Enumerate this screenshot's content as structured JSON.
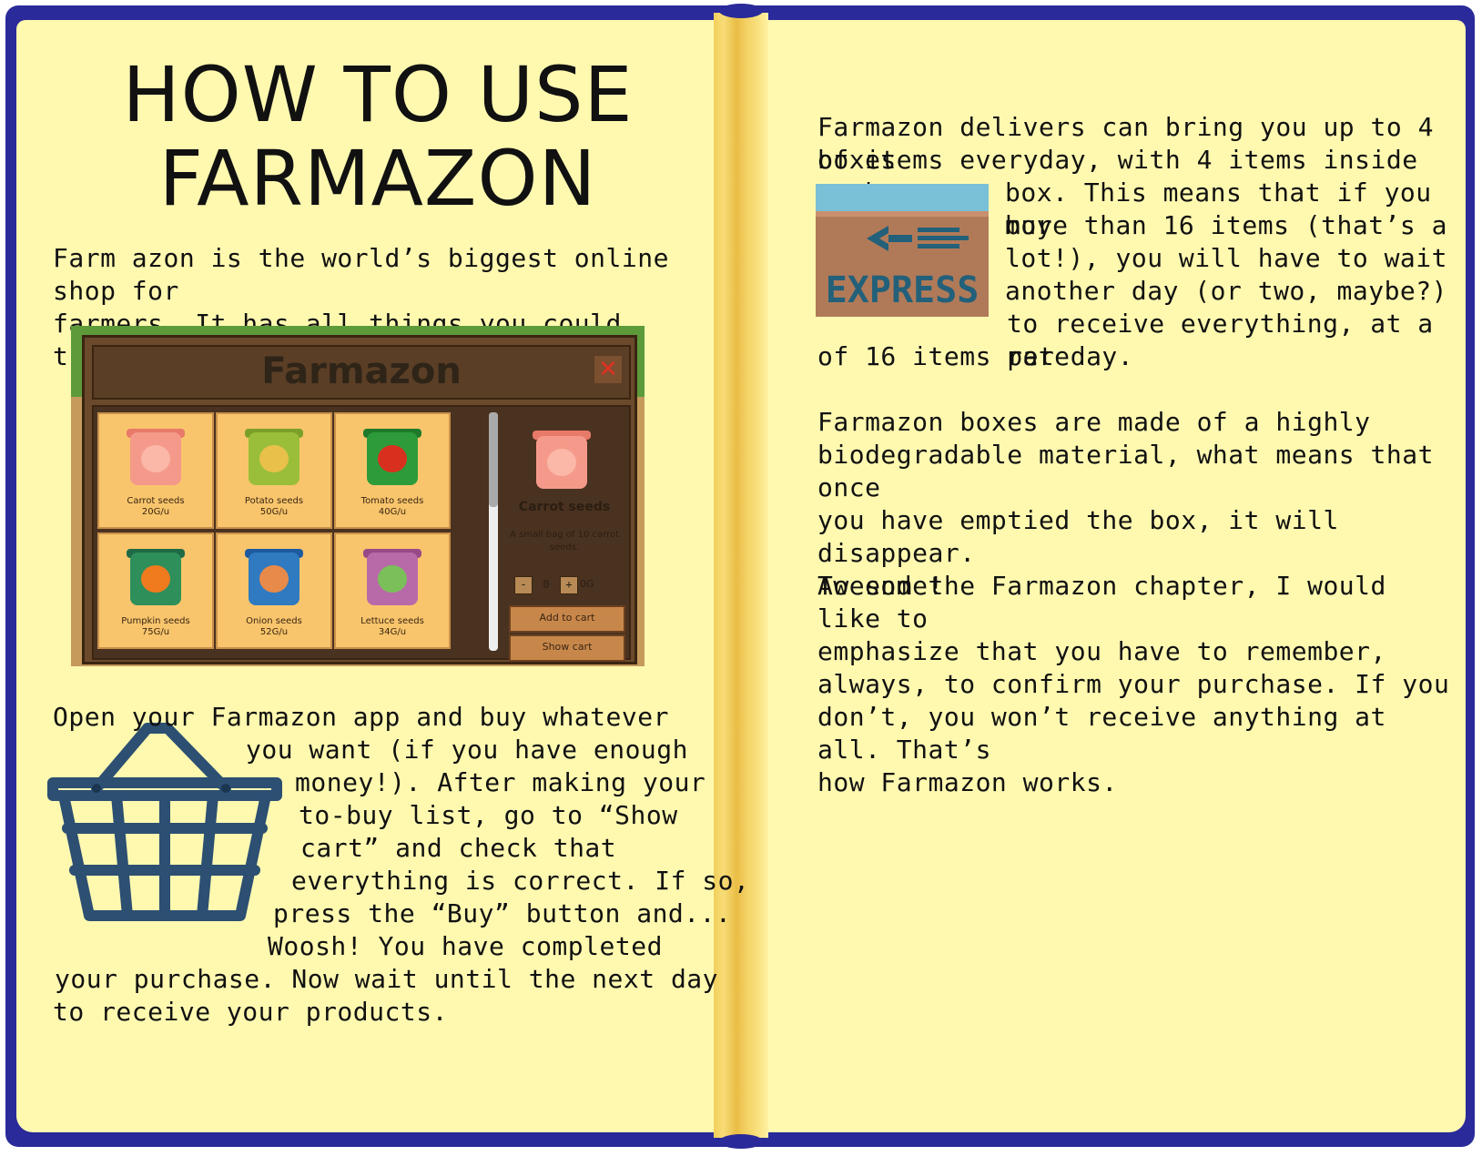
{
  "left_page": {
    "title_line1": "HOW TO USE",
    "title_line2": "FARMAZON",
    "intro": "Farm azon is the world’s biggest online shop for\nfarmers. It has all things you could think of.",
    "howto_l1": "Open your Farmazon app and buy whatever",
    "howto_l2": "you want (if you have enough",
    "howto_l3": "money!). After making your",
    "howto_l4": "to-buy list, go to “Show",
    "howto_l5": "cart” and check that",
    "howto_l6": "everything  is correct. If so,",
    "howto_l7": "press the “Buy” button and...",
    "howto_l8": "Woosh!  You have completed",
    "howto_l9": "your  purchase. Now wait until the next day",
    "howto_l10": "to receive your products."
  },
  "shop": {
    "title": "Farmazon",
    "close": "✕",
    "tiles": [
      {
        "name": "Carrot seeds",
        "price": "20G/u",
        "color": "#f59a8a",
        "lid": "#e87a6a",
        "dot": "#fbb7a7"
      },
      {
        "name": "Potato seeds",
        "price": "50G/u",
        "color": "#9bbe3a",
        "lid": "#7aa02a",
        "dot": "#e8c04a"
      },
      {
        "name": "Tomato seeds",
        "price": "40G/u",
        "color": "#2e9b3a",
        "lid": "#1e7a2a",
        "dot": "#d8301e"
      },
      {
        "name": "Pumpkin seeds",
        "price": "75G/u",
        "color": "#2e8f5a",
        "lid": "#1e6a45",
        "dot": "#f07a1e"
      },
      {
        "name": "Onion seeds",
        "price": "52G/u",
        "color": "#2f7ac0",
        "lid": "#1e5aa0",
        "dot": "#e88a4a"
      },
      {
        "name": "Lettuce seeds",
        "price": "34G/u",
        "color": "#b86aa8",
        "lid": "#984a88",
        "dot": "#7abf5a"
      }
    ],
    "detail": {
      "name": "Carrot seeds",
      "desc": "A small bag of 10 carrot seeds.",
      "minus": "-",
      "qty": "0",
      "plus": "+",
      "price": "0G",
      "add_to_cart": "Add to cart",
      "show_cart": "Show cart"
    }
  },
  "right_page": {
    "p1_l1": "Farmazon delivers can bring you up to 4 boxes",
    "p1_l2": "of items everyday, with 4 items inside each",
    "p1_l3": "box. This means that if you buy",
    "p1_l4": "more  than  16 items (that’s a",
    "p1_l5": "lot!), you will have to wait",
    "p1_l6": "another day (or two, maybe?)",
    "p1_l7": "to receive everything, at a rate",
    "p1_l8": "of 16 items per day.",
    "p2": "Farmazon boxes are made of a highly\nbiodegradable material, what means that once\nyou have  emptied the box, it will disappear.\nAwesome!",
    "p3": "To end the Farmazon chapter, I would like to\nemphasize  that you have to remember,\nalways, to confirm your purchase. If you\ndon’t, you won’t receive anything at all. That’s\nhow Farmazon works.",
    "express_label": "EXPRESS"
  },
  "colors": {
    "cover": "#2a2a9a",
    "page": "#fff9b0",
    "basket": "#2c4f72",
    "box": "#b07a58",
    "box_band": "#7ac0d6"
  }
}
